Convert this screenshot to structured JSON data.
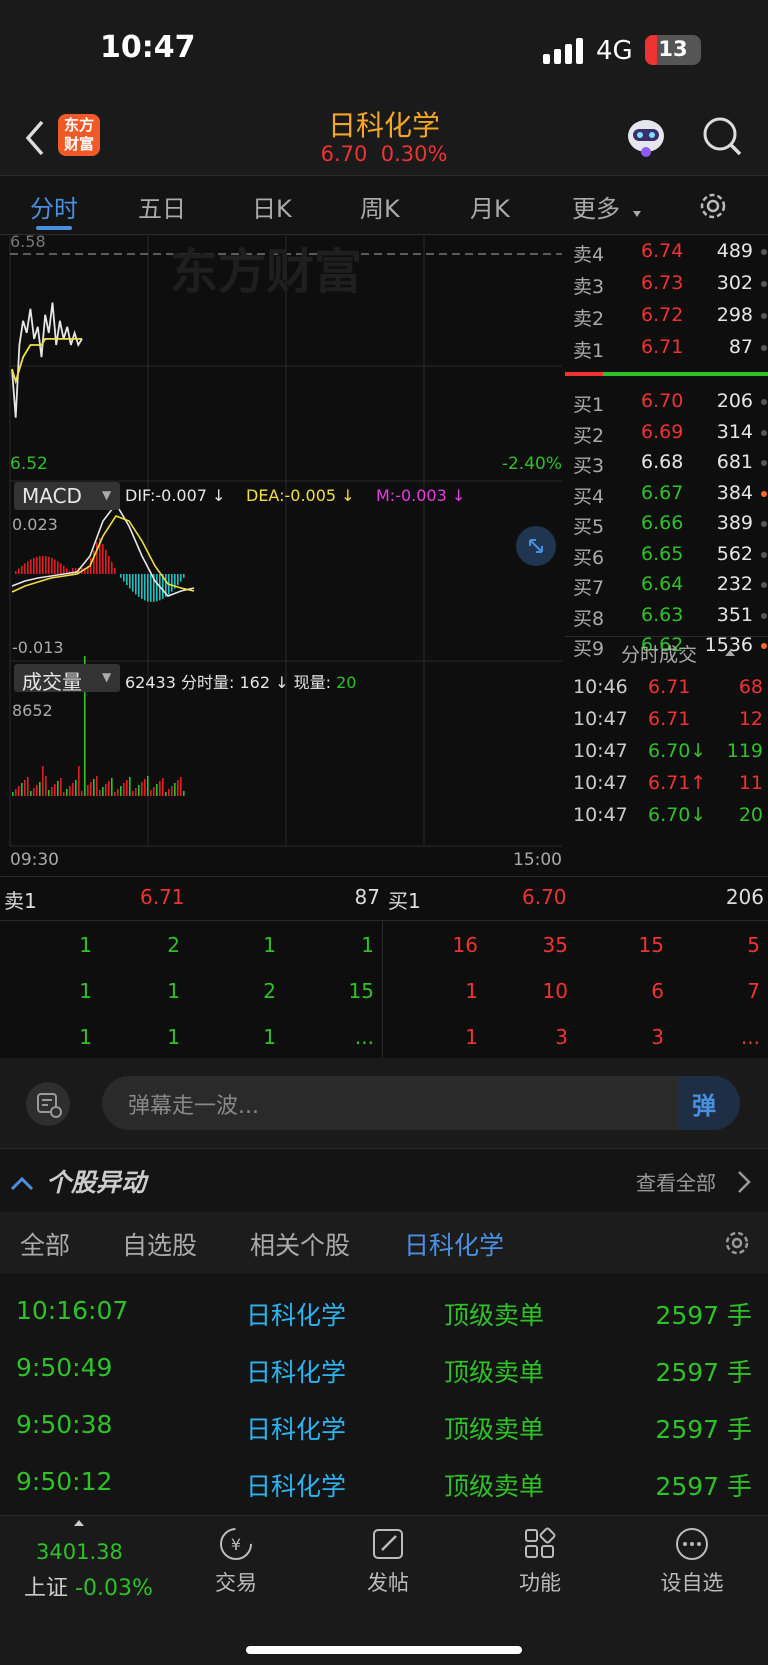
{
  "status_bar": {
    "time": "10:47",
    "network": "4G",
    "battery": "13"
  },
  "header": {
    "logo_text_1": "东方",
    "logo_text_2": "财富",
    "stock_name": "日科化学",
    "price": "6.70",
    "change_pct": "0.30%"
  },
  "tabs": [
    "分时",
    "五日",
    "日K",
    "周K",
    "月K",
    "更多"
  ],
  "chart": {
    "watermark": "东方财富",
    "ref_price_partial": "6.58",
    "low_price": "6.52",
    "low_pct": "-2.40%",
    "macd": {
      "selector": "MACD",
      "dif": "DIF:-0.007 ↓",
      "dea": "DEA:-0.005 ↓",
      "m": "M:-0.003 ↓",
      "top": "0.023",
      "bottom": "-0.013"
    },
    "volume": {
      "selector": "成交量",
      "total": "62433",
      "fs_label": "分时量: 162 ↓",
      "now_label": "现量:",
      "now_value": "20",
      "max": "8652"
    },
    "time_start": "09:30",
    "time_end": "15:00"
  },
  "chart_data": {
    "type": "line",
    "title": "",
    "xlabel": "",
    "ylabel": "",
    "x_range": [
      "09:30",
      "15:00"
    ],
    "ylim": [
      6.52,
      6.88
    ],
    "series": [
      {
        "values": [
          6.66,
          6.58,
          6.7,
          6.74,
          6.72,
          6.76,
          6.71,
          6.73,
          6.68,
          6.75,
          6.72,
          6.77,
          6.7,
          6.74,
          6.71,
          6.73,
          6.7,
          6.72,
          6.7,
          6.71
        ]
      },
      {
        "values": [
          6.66,
          6.64,
          6.66,
          6.68,
          6.69,
          6.7,
          6.7,
          6.7,
          6.7,
          6.71,
          6.71,
          6.71,
          6.71,
          6.71,
          6.71,
          6.71,
          6.71,
          6.71,
          6.71,
          6.71
        ]
      }
    ]
  },
  "order_book": {
    "asks": [
      {
        "label": "卖4",
        "price": "6.74",
        "vol": "489"
      },
      {
        "label": "卖3",
        "price": "6.73",
        "vol": "302"
      },
      {
        "label": "卖2",
        "price": "6.72",
        "vol": "298"
      },
      {
        "label": "卖1",
        "price": "6.71",
        "vol": "87"
      }
    ],
    "bids": [
      {
        "label": "买1",
        "price": "6.70",
        "vol": "206",
        "color": "#ee3333"
      },
      {
        "label": "买2",
        "price": "6.69",
        "vol": "314",
        "color": "#ee3333"
      },
      {
        "label": "买3",
        "price": "6.68",
        "vol": "681",
        "color": "#e6e6e6"
      },
      {
        "label": "买4",
        "price": "6.67",
        "vol": "384",
        "color": "#2ec228"
      },
      {
        "label": "买5",
        "price": "6.66",
        "vol": "389",
        "color": "#2ec228"
      },
      {
        "label": "买6",
        "price": "6.65",
        "vol": "562",
        "color": "#2ec228"
      },
      {
        "label": "买7",
        "price": "6.64",
        "vol": "232",
        "color": "#2ec228"
      },
      {
        "label": "买8",
        "price": "6.63",
        "vol": "351",
        "color": "#2ec228"
      },
      {
        "label": "买9",
        "price": "6.62",
        "vol": "1536",
        "color": "#2ec228"
      }
    ],
    "trades_title": "分时成交",
    "trades": [
      {
        "time": "10:46",
        "price": "6.71",
        "vol": "68",
        "color": "#ee3333"
      },
      {
        "time": "10:47",
        "price": "6.71",
        "vol": "12",
        "color": "#ee3333"
      },
      {
        "time": "10:47",
        "price": "6.70↓",
        "vol": "119",
        "color": "#2ec228"
      },
      {
        "time": "10:47",
        "price": "6.71↑",
        "vol": "11",
        "color": "#ee3333"
      },
      {
        "time": "10:47",
        "price": "6.70↓",
        "vol": "20",
        "color": "#2ec228"
      }
    ]
  },
  "depth": {
    "ask_label": "卖1",
    "ask_price": "6.71",
    "ask_vol": "87",
    "bid_label": "买1",
    "bid_price": "6.70",
    "bid_vol": "206",
    "ask_queue": [
      [
        "1",
        "2",
        "1",
        "1"
      ],
      [
        "1",
        "1",
        "2",
        "15"
      ],
      [
        "1",
        "1",
        "1",
        "..."
      ]
    ],
    "bid_queue": [
      [
        "16",
        "35",
        "15",
        "5"
      ],
      [
        "1",
        "10",
        "6",
        "7"
      ],
      [
        "1",
        "3",
        "3",
        "..."
      ]
    ]
  },
  "danmu": {
    "placeholder": "弹幕走一波...",
    "button": "弹"
  },
  "anomaly": {
    "title": "个股异动",
    "view_all": "查看全部"
  },
  "filters": [
    "全部",
    "自选股",
    "相关个股",
    "日科化学"
  ],
  "events": [
    {
      "time": "10:16:07",
      "stock": "日科化学",
      "type": "顶级卖单",
      "amount": "2597 手"
    },
    {
      "time": "9:50:49",
      "stock": "日科化学",
      "type": "顶级卖单",
      "amount": "2597 手"
    },
    {
      "time": "9:50:38",
      "stock": "日科化学",
      "type": "顶级卖单",
      "amount": "2597 手"
    },
    {
      "time": "9:50:12",
      "stock": "日科化学",
      "type": "顶级卖单",
      "amount": "2597 手"
    }
  ],
  "bottom_nav": {
    "index_value": "3401.38",
    "index_name": "上证",
    "index_pct": "-0.03%",
    "trade": "交易",
    "post": "发帖",
    "func": "功能",
    "watch": "设自选"
  }
}
